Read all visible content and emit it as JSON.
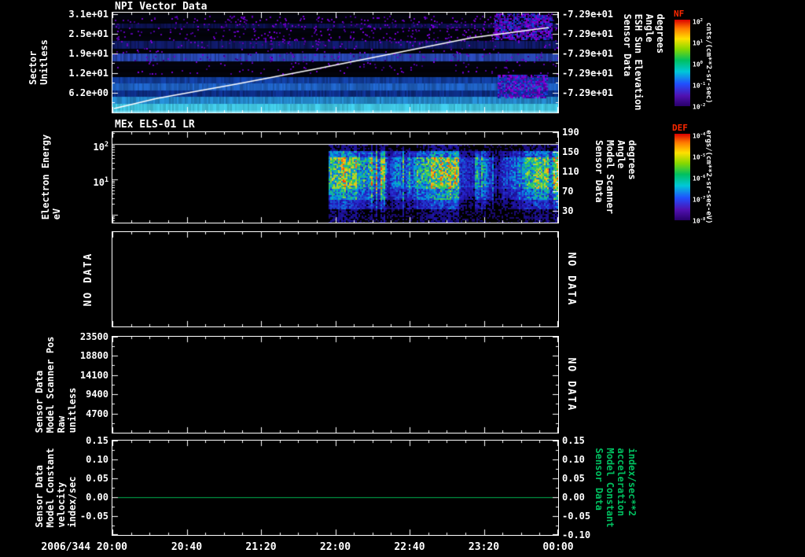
{
  "figure": {
    "background": "#000000",
    "text_color": "#ffffff",
    "accent_green": "#00c060",
    "colorbar_title_color": "#ff2800"
  },
  "no_data_label": "NO DATA",
  "time_axis": {
    "start_label": "2006/344 20:00",
    "full_labels": [
      "2006/344 20:00",
      "20:40",
      "21:20",
      "22:00",
      "22:40",
      "23:20",
      "00:00"
    ],
    "x_range": [
      "2006/344 20:00",
      "2006/345 00:00"
    ]
  },
  "chart_data": [
    {
      "type": "heatmap",
      "title": "NPI Vector Data",
      "ylabel_lines": [
        "Sector",
        "Unitless"
      ],
      "y_ticks": [
        "3.1e+01",
        "2.5e+01",
        "1.9e+01",
        "1.2e+01",
        "6.2e+00"
      ],
      "y_range": [
        0,
        32
      ],
      "right_axis": {
        "label_lines": [
          "Sensor Data",
          "ESH Sun Elevation",
          "Angle",
          "degrees"
        ],
        "ticks": [
          "-7.29e+01",
          "-7.29e+01",
          "-7.29e+01",
          "-7.29e+01",
          "-7.29e+01"
        ],
        "constant_value": -72.9
      },
      "colorbar": {
        "title": "NF",
        "units": "cnts/(cm**2-sr-sec)",
        "scale": "log",
        "tick_exponents": [
          "2",
          "1",
          "0",
          "-1",
          "-2"
        ]
      },
      "overlay_line": {
        "color": "#ffffff",
        "description": "diagonal line rising from sector ~1 at 20:00 to sector ~28 near 23:50"
      },
      "features": "horizontal blue/cyan count bands across full interval, brightest in lowest sectors; scattered purple low-count pixels in upper sectors; enhanced purple patches near end of interval"
    },
    {
      "type": "heatmap",
      "title": "MEx ELS-01 LR",
      "ylabel_lines": [
        "Electron Energy",
        "eV"
      ],
      "yscale": "log",
      "y_tick_exponents": [
        "2",
        "1"
      ],
      "right_axis": {
        "label_lines": [
          "Sensor Data",
          "Model Scanner",
          "Angle",
          "degrees"
        ],
        "ticks": [
          "190",
          "150",
          "110",
          "70",
          "30"
        ]
      },
      "colorbar": {
        "title": "DEF",
        "units": "ergs/(cm**2-sr-sec-eV)",
        "scale": "log",
        "tick_exponents": [
          "-4",
          "-5",
          "-6",
          "-7",
          "-8"
        ]
      },
      "data_start": "22:00",
      "overlay_line": {
        "color": "#ffffff",
        "description": "horizontal line at ~100 eV across full interval"
      },
      "features": "electron flux present only from ~22:00 to 00:00; green-cyan with yellow/orange vertical streaks between ~5 and ~100 eV; sparse dark-blue noise at lowest energies"
    },
    {
      "type": "empty",
      "no_data_label": "NO DATA"
    },
    {
      "type": "empty",
      "no_data_label": "NO DATA",
      "ylabel_lines": [
        "Sensor Data",
        "Model Scanner Pos",
        "Raw",
        "unitless"
      ],
      "y_ticks": [
        "23500",
        "18800",
        "14100",
        "9400",
        "4700"
      ],
      "ylim": [
        0,
        23500
      ]
    },
    {
      "type": "line",
      "ylabel_lines": [
        "Sensor Data",
        "Model Constant",
        "velocity",
        "index/sec"
      ],
      "y_ticks": [
        "0.15",
        "0.10",
        "0.05",
        "0.00",
        "-0.05"
      ],
      "ylim": [
        -0.1,
        0.15
      ],
      "right_axis": {
        "label_lines": [
          "Sensor Data",
          "Model Constant",
          "acceleration",
          "index/sec**2"
        ],
        "ticks": [
          "0.15",
          "0.10",
          "0.05",
          "0.00",
          "-0.05",
          "-0.10"
        ],
        "color": "#00c060"
      },
      "series": [
        {
          "name": "constant value",
          "color": "#00b050",
          "constant_value": 0.0
        }
      ]
    }
  ]
}
